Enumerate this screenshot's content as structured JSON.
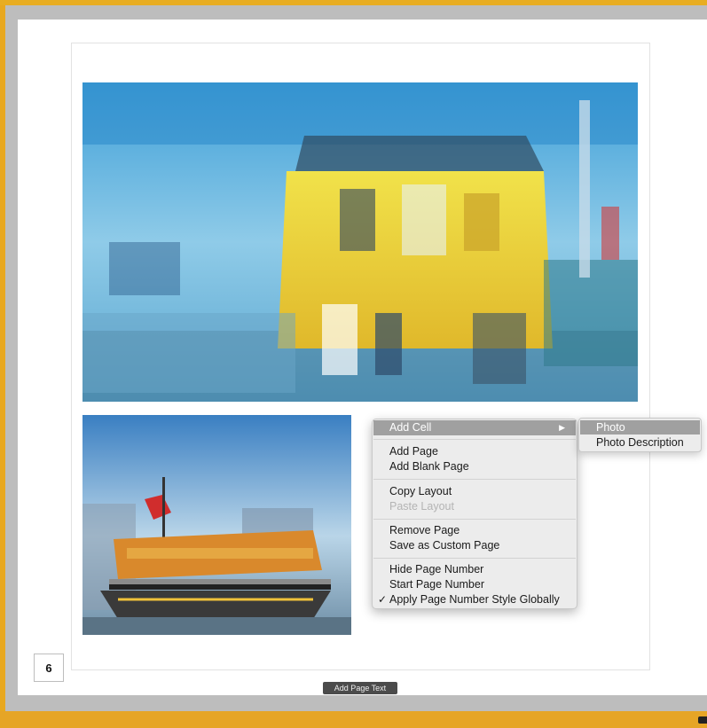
{
  "page": {
    "page_number": "6",
    "add_page_text_label": "Add Page Text"
  },
  "context_menu": {
    "items": [
      {
        "label": "Add Cell",
        "highlighted": true,
        "has_submenu": true
      },
      {
        "label": "Add Page"
      },
      {
        "label": "Add Blank Page"
      },
      {
        "label": "Copy Layout"
      },
      {
        "label": "Paste Layout",
        "disabled": true
      },
      {
        "label": "Remove Page"
      },
      {
        "label": "Save as Custom Page"
      },
      {
        "label": "Hide Page Number"
      },
      {
        "label": "Start Page Number"
      },
      {
        "label": "Apply Page Number Style Globally",
        "checked": true
      }
    ],
    "submenu_arrow": "▶",
    "check_mark": "✓"
  },
  "submenu": {
    "items": [
      {
        "label": "Photo",
        "highlighted": true
      },
      {
        "label": "Photo Description"
      }
    ]
  },
  "colors": {
    "accent": "#e8ad22",
    "highlight": "#a0a0a0",
    "menu_bg": "#ececec"
  }
}
